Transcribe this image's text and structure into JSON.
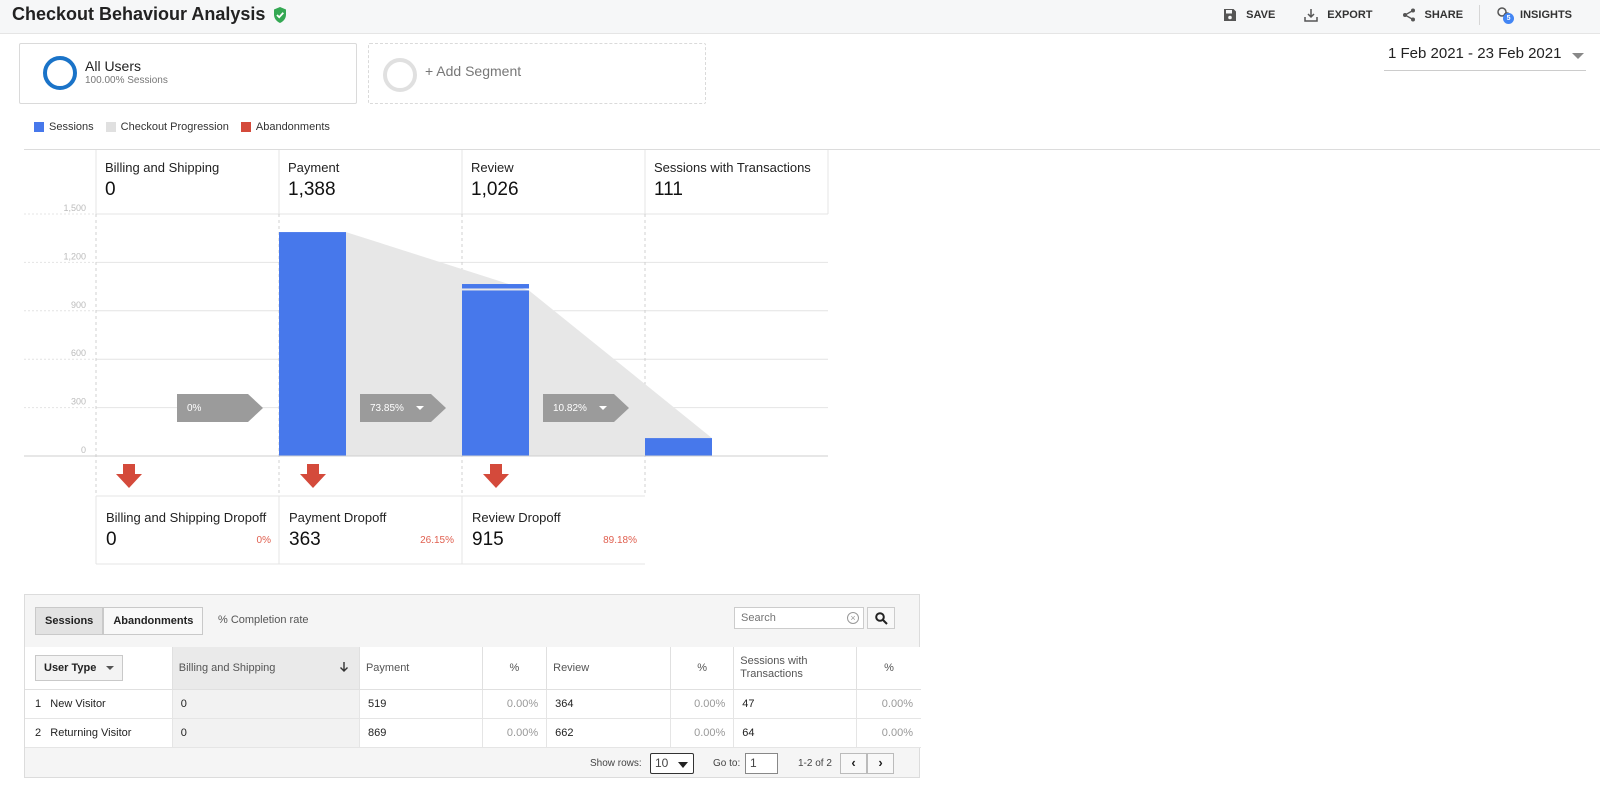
{
  "header": {
    "title": "Checkout Behaviour Analysis",
    "actions": {
      "save": "SAVE",
      "export": "EXPORT",
      "share": "SHARE",
      "insights": "INSIGHTS",
      "insights_badge": "5"
    }
  },
  "segments": {
    "active": {
      "name": "All Users",
      "sub": "100.00% Sessions"
    },
    "add": "+ Add Segment"
  },
  "date_range": "1 Feb 2021 - 23 Feb 2021",
  "legend": {
    "sessions": "Sessions",
    "progression": "Checkout Progression",
    "abandonments": "Abandonments"
  },
  "colors": {
    "sessions": "#4778eb",
    "progression": "#e7e7e7",
    "abandonments": "#d44a3b",
    "brand_blue": "#1a73c8"
  },
  "chart_data": {
    "type": "bar",
    "y_ticks": [
      "0",
      "300",
      "600",
      "900",
      "1,200",
      "1,500"
    ],
    "ylim": [
      0,
      1500
    ],
    "steps": [
      {
        "name": "Billing and Shipping",
        "value_label": "0",
        "value": 0,
        "conversion": "0%",
        "dropoff_name": "Billing and Shipping Dropoff",
        "dropoff_value": "0",
        "dropoff_pct": "0%"
      },
      {
        "name": "Payment",
        "value_label": "1,388",
        "value": 1388,
        "conversion": "73.85%",
        "dropoff_name": "Payment Dropoff",
        "dropoff_value": "363",
        "dropoff_pct": "26.15%"
      },
      {
        "name": "Review",
        "value_label": "1,026",
        "value": 1026,
        "inflow": 40,
        "conversion": "10.82%",
        "dropoff_name": "Review Dropoff",
        "dropoff_value": "915",
        "dropoff_pct": "89.18%"
      },
      {
        "name": "Sessions with Transactions",
        "value_label": "111",
        "value": 111
      }
    ]
  },
  "table": {
    "tabs": [
      "Sessions",
      "Abandonments"
    ],
    "completion_link": "% Completion rate",
    "search_placeholder": "Search",
    "dimension_label": "User Type",
    "headers": [
      "Billing and Shipping",
      "Payment",
      "%",
      "Review",
      "%",
      "Sessions with Transactions",
      "%"
    ],
    "rows": [
      {
        "index": "1",
        "name": "New Visitor",
        "cells": [
          "0",
          "519",
          "0.00%",
          "364",
          "0.00%",
          "47",
          "0.00%"
        ]
      },
      {
        "index": "2",
        "name": "Returning Visitor",
        "cells": [
          "0",
          "869",
          "0.00%",
          "662",
          "0.00%",
          "64",
          "0.00%"
        ]
      }
    ],
    "footer": {
      "show_rows_label": "Show rows:",
      "show_rows_value": "10",
      "goto_label": "Go to:",
      "goto_value": "1",
      "range": "1-2 of 2"
    }
  }
}
